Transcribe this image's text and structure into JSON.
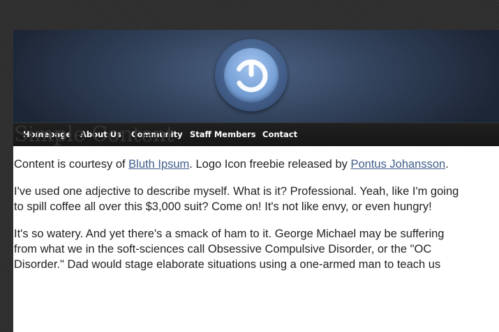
{
  "header": {
    "logo": "power-icon"
  },
  "nav": {
    "items": [
      {
        "label": "Homepage"
      },
      {
        "label": "About Us"
      },
      {
        "label": "Community"
      },
      {
        "label": "Staff Members"
      },
      {
        "label": "Contact"
      }
    ]
  },
  "content": {
    "title": "Simple Content",
    "credit": {
      "prefix": "Content is courtesy of ",
      "link1": "Bluth Ipsum",
      "middle": ". Logo Icon freebie released by ",
      "link2": "Pontus Johansson",
      "suffix": "."
    },
    "paragraphs": [
      "I've used one adjective to describe myself. What is it? Professional. Yeah, like I'm going to spill coffee all over this $3,000 suit? Come on! It's not like envy, or even hungry!",
      "It's so watery. And yet there's a smack of ham to it. George Michael may be suffering from what we in the soft-sciences call Obsessive Compulsive Disorder, or the \"OC Disorder.\" Dad would stage elaborate situations using a one-armed man to teach us"
    ]
  },
  "colors": {
    "link": "#3f5d8a",
    "nav_bg": "#1a1a1a",
    "header_bg": "#34455f"
  }
}
